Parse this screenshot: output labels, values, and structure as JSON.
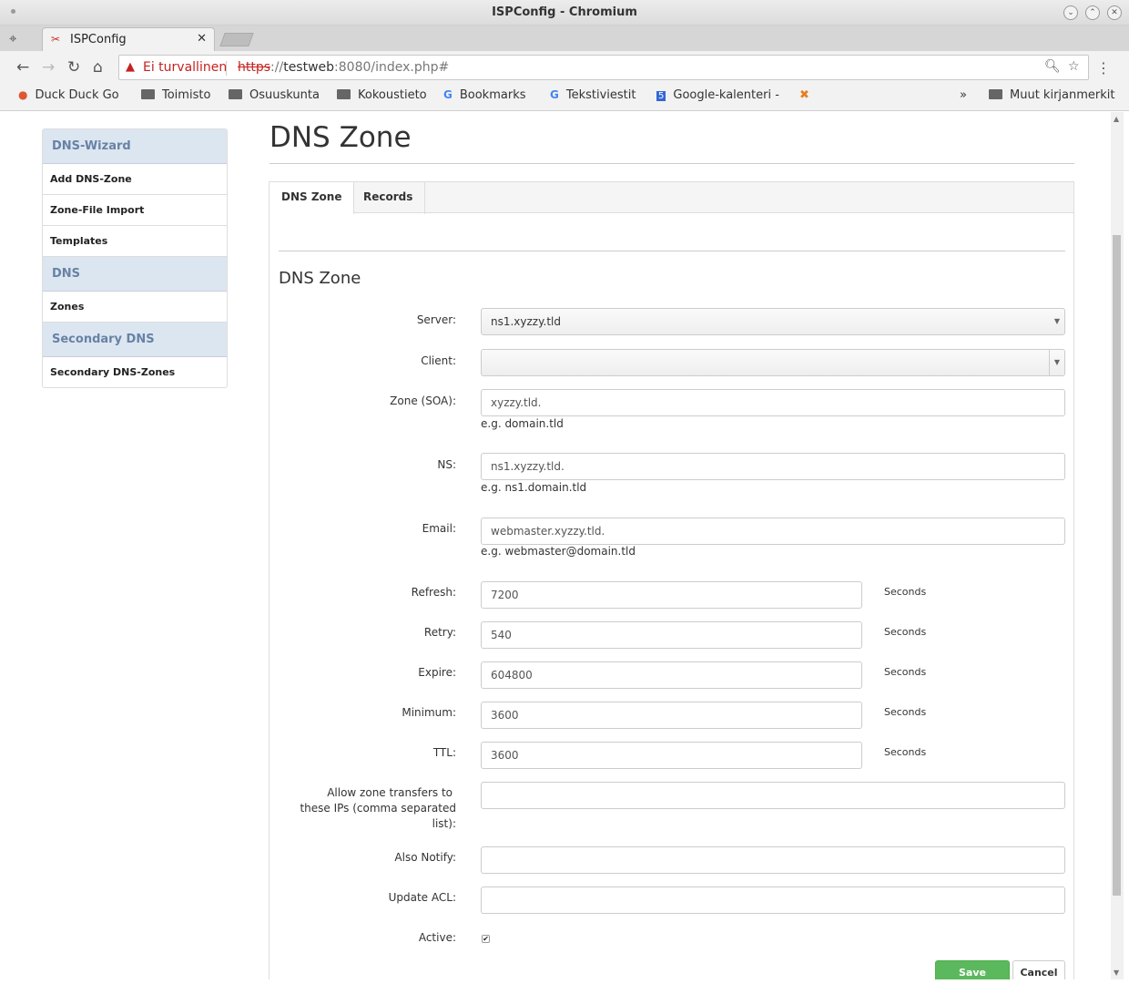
{
  "window": {
    "title": "ISPConfig - Chromium"
  },
  "browser": {
    "tab_title": "ISPConfig",
    "security_label": "Ei turvallinen",
    "url_protocol": "https",
    "url_sep": "://",
    "url_host": "testweb",
    "url_path": ":8080/index.php#",
    "bookmarks": [
      "Duck Duck Go",
      "Toimisto",
      "Osuuskunta",
      "Kokoustieto",
      "Bookmarks",
      "Tekstiviestit",
      "Google-kalenteri -"
    ],
    "bookmarks_overflow": "»",
    "other_bookmarks": "Muut kirjanmerkit"
  },
  "sidebar": {
    "sections": [
      {
        "heading": "DNS-Wizard",
        "items": [
          "Add DNS-Zone",
          "Zone-File Import",
          "Templates"
        ]
      },
      {
        "heading": "DNS",
        "items": [
          "Zones"
        ]
      },
      {
        "heading": "Secondary DNS",
        "items": [
          "Secondary DNS-Zones"
        ]
      }
    ]
  },
  "main": {
    "page_title": "DNS Zone",
    "tabs": [
      "DNS Zone",
      "Records"
    ],
    "section_title": "DNS Zone",
    "fields": {
      "server": {
        "label": "Server:",
        "value": "ns1.xyzzy.tld"
      },
      "client": {
        "label": "Client:",
        "value": ""
      },
      "zone": {
        "label": "Zone (SOA):",
        "value": "xyzzy.tld.",
        "hint": "e.g. domain.tld"
      },
      "ns": {
        "label": "NS:",
        "value": "ns1.xyzzy.tld.",
        "hint": "e.g. ns1.domain.tld"
      },
      "email": {
        "label": "Email:",
        "value": "webmaster.xyzzy.tld.",
        "hint": "e.g. webmaster@domain.tld"
      },
      "refresh": {
        "label": "Refresh:",
        "value": "7200",
        "unit": "Seconds"
      },
      "retry": {
        "label": "Retry:",
        "value": "540",
        "unit": "Seconds"
      },
      "expire": {
        "label": "Expire:",
        "value": "604800",
        "unit": "Seconds"
      },
      "minimum": {
        "label": "Minimum:",
        "value": "3600",
        "unit": "Seconds"
      },
      "ttl": {
        "label": "TTL:",
        "value": "3600",
        "unit": "Seconds"
      },
      "transfers": {
        "label_1": "Allow zone transfers to",
        "label_2": "these IPs (comma separated",
        "label_3": "list):",
        "value": ""
      },
      "also_notify": {
        "label": "Also Notify:",
        "value": ""
      },
      "update_acl": {
        "label": "Update ACL:",
        "value": ""
      },
      "active": {
        "label": "Active:",
        "checked": true,
        "mark": "✔"
      }
    },
    "buttons": {
      "save": "Save",
      "cancel": "Cancel"
    }
  }
}
